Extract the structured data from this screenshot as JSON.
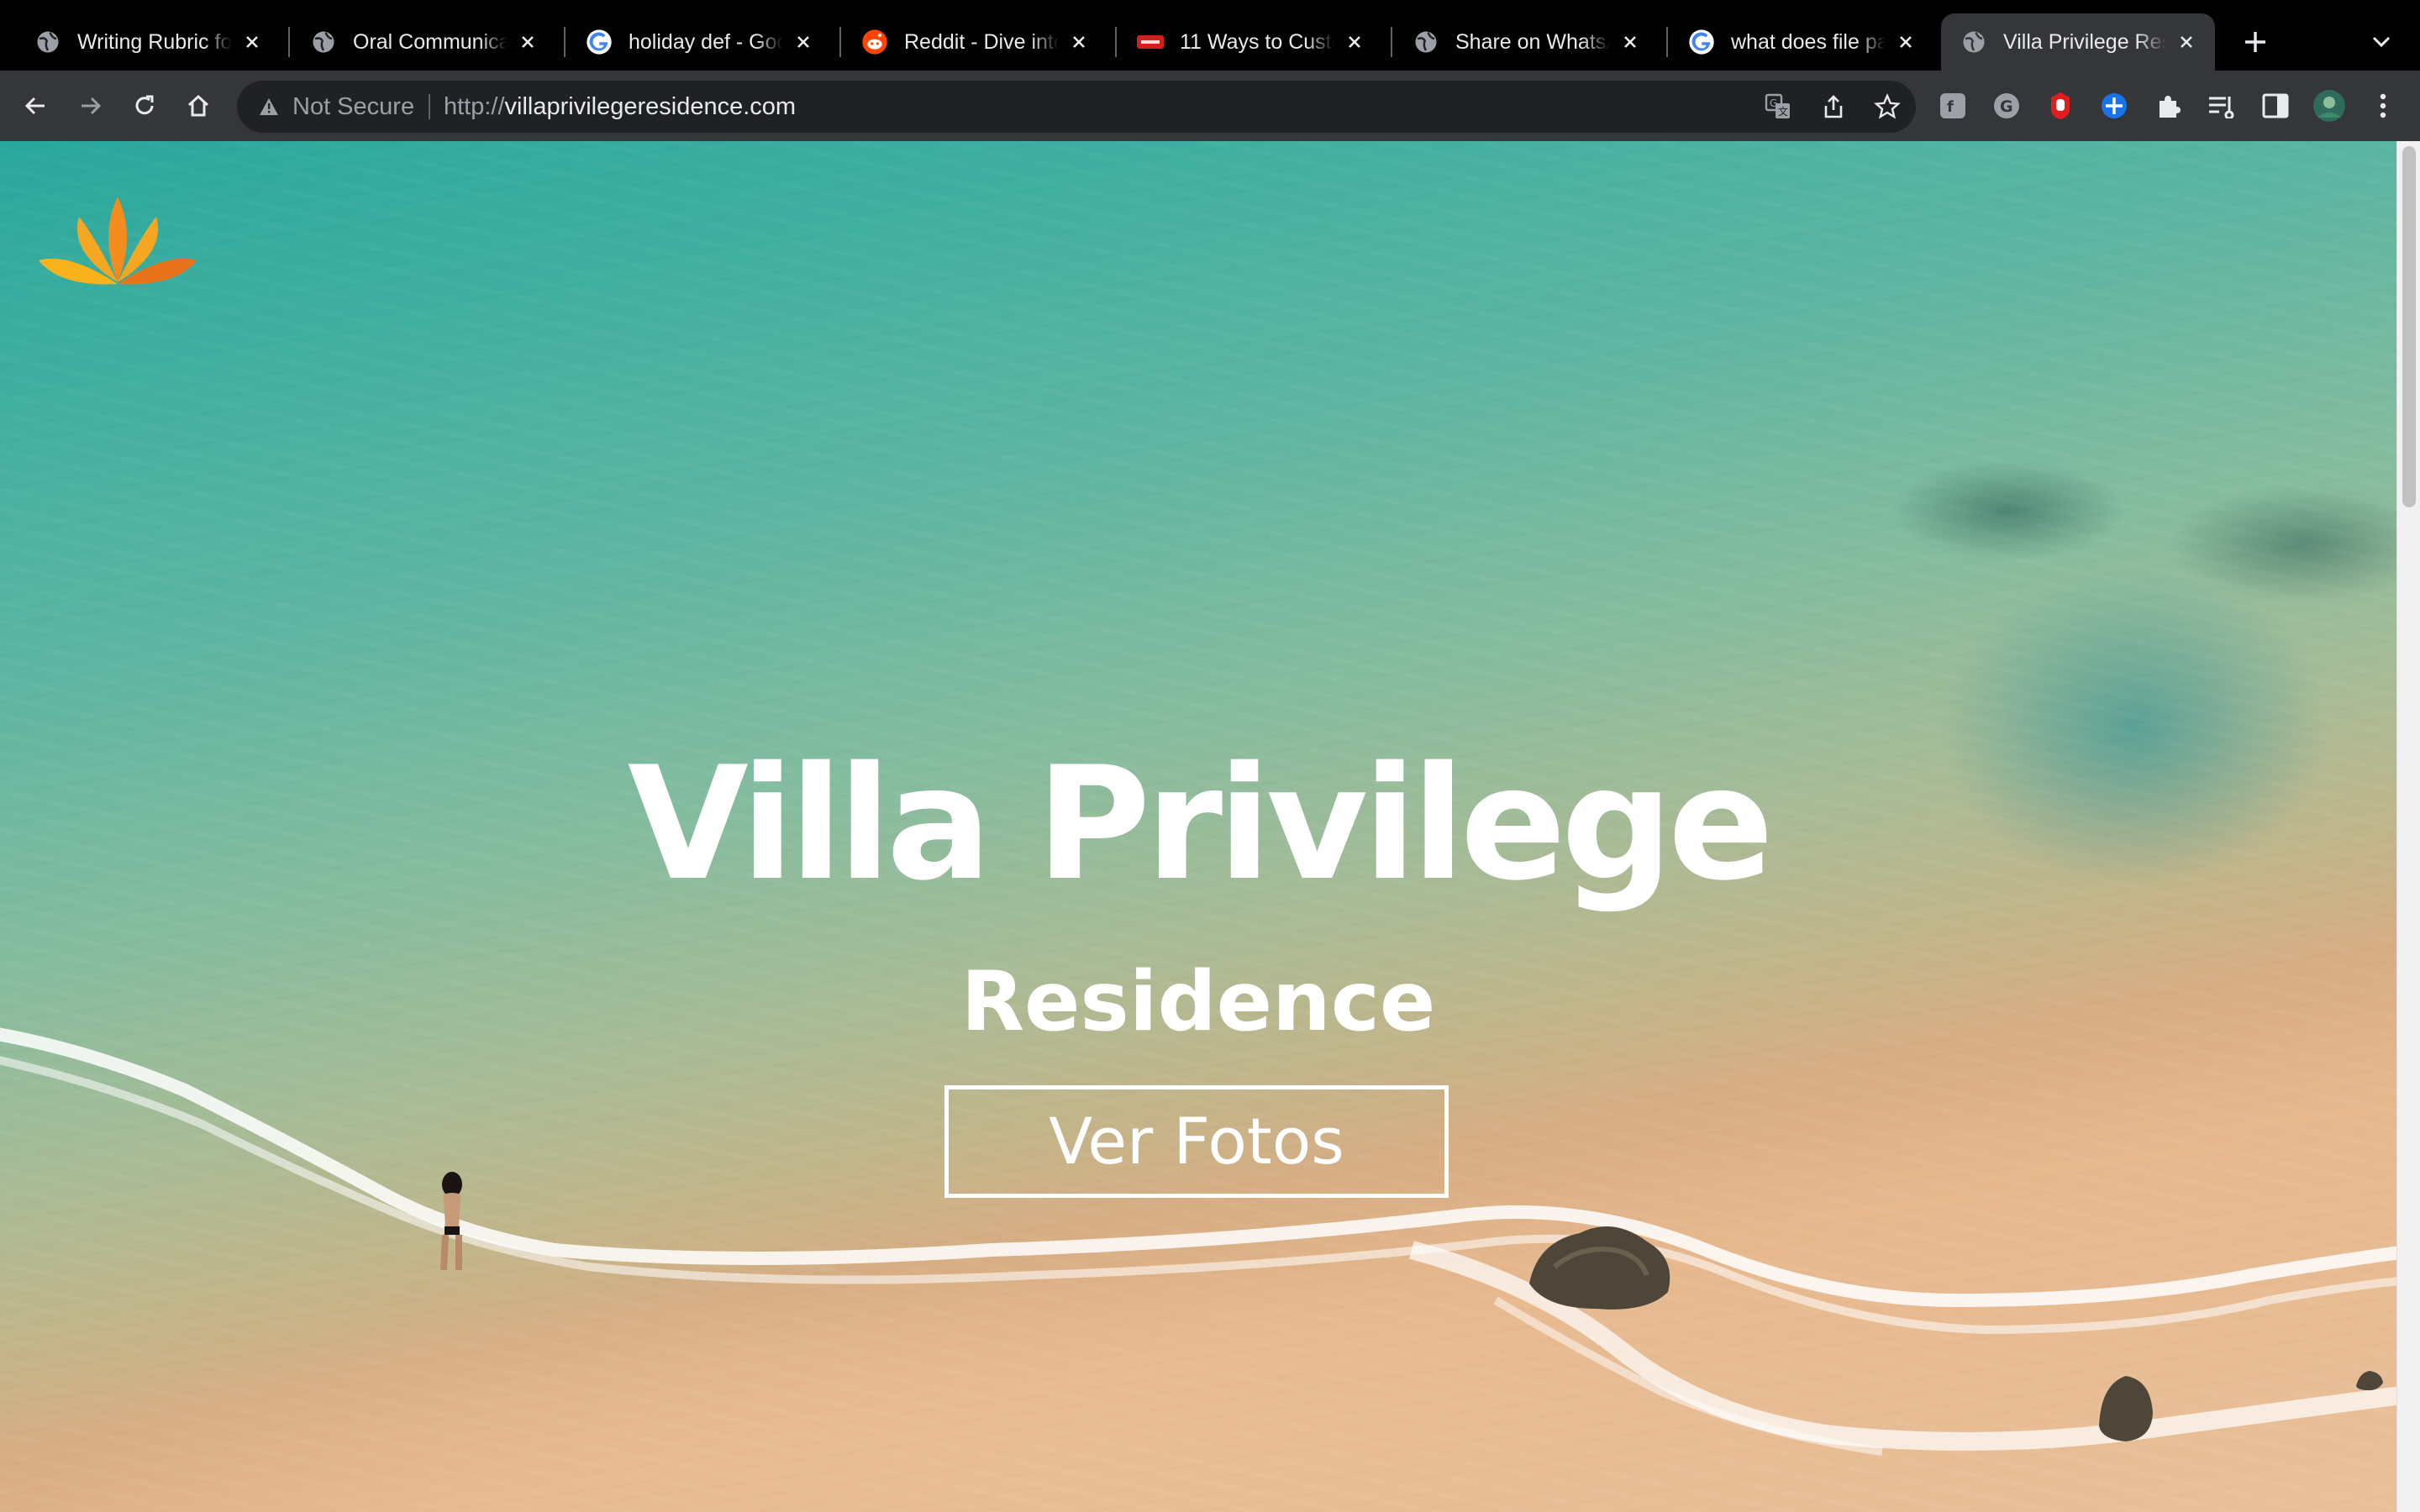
{
  "browser": {
    "tabs": [
      {
        "title": "Writing Rubric for",
        "favicon": "globe-icon"
      },
      {
        "title": "Oral Communicat",
        "favicon": "globe-icon"
      },
      {
        "title": "holiday def - Goo",
        "favicon": "google-icon"
      },
      {
        "title": "Reddit - Dive into",
        "favicon": "reddit-icon"
      },
      {
        "title": "11 Ways to Custor",
        "favicon": "hud-icon"
      },
      {
        "title": "Share on WhatsA",
        "favicon": "globe-icon"
      },
      {
        "title": "what does file pa",
        "favicon": "google-icon"
      },
      {
        "title": "Villa Privilege Res",
        "favicon": "globe-icon",
        "active": true
      }
    ],
    "security_label": "Not Secure",
    "url_scheme": "http://",
    "url_host": "villaprivilegeresidence.com",
    "icons": {
      "back": "back-arrow-icon",
      "forward": "forward-arrow-icon",
      "reload": "reload-icon",
      "home": "home-icon",
      "translate": "translate-icon",
      "share": "share-icon",
      "bookmark": "star-icon",
      "extensions": "puzzle-icon",
      "reading_list": "reading-list-icon",
      "side_panel": "side-panel-icon",
      "menu": "kebab-menu-icon"
    }
  },
  "page": {
    "hero_title": "Villa Privilege",
    "hero_subtitle": "Residence",
    "cta_label": "Ver Fotos",
    "logo": "lotus-logo"
  },
  "colors": {
    "tabstrip": "#000000",
    "toolbar": "#35363a",
    "omnibox": "#202124",
    "logo_orange": "#f28c1e",
    "logo_amber": "#f5a623",
    "water": "#2aa79d",
    "sand": "#e8c09a"
  }
}
